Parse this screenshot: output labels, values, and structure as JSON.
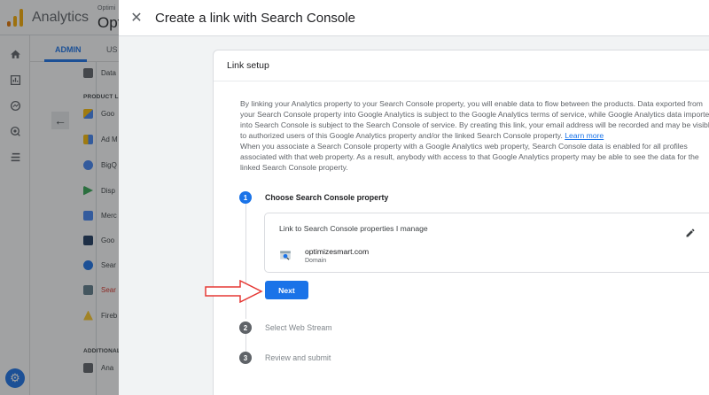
{
  "app": {
    "name": "Analytics",
    "account_label": "Optimi",
    "property_label": "Opt"
  },
  "tabs": [
    {
      "label": "ADMIN",
      "active": true
    },
    {
      "label": "US",
      "active": false
    }
  ],
  "left_nav_icons": [
    "home-icon",
    "reports-icon",
    "explore-icon",
    "advertising-icon",
    "configure-icon"
  ],
  "panel": {
    "top_item": {
      "label": "Data",
      "icon": "data-import-icon"
    },
    "section_product_links": "PRODUCT L",
    "product_links": [
      {
        "label": "Goo",
        "icon": "google-ads-icon"
      },
      {
        "label": "Ad M",
        "icon": "ad-manager-icon"
      },
      {
        "label": "BigQ",
        "icon": "bigquery-icon"
      },
      {
        "label": "Disp",
        "icon": "display-video-icon"
      },
      {
        "label": "Merc",
        "icon": "merchant-center-icon"
      },
      {
        "label": "Goo",
        "icon": "google-play-icon"
      },
      {
        "label": "Sear",
        "icon": "search-ads-icon"
      },
      {
        "label": "Sear",
        "icon": "search-console-icon"
      },
      {
        "label": "Fireb",
        "icon": "firebase-icon"
      }
    ],
    "section_additional": "ADDITIONAL",
    "additional_items": [
      {
        "label": "Ana",
        "icon": "analytics-intelligence-icon"
      }
    ]
  },
  "sheet": {
    "title": "Create a link with Search Console",
    "card_title": "Link setup",
    "intro_text": "By linking your Analytics property to your Search Console property, you will enable data to flow between the products. Data exported from your Search Console property into Google Analytics is subject to the Google Analytics terms of service, while Google Analytics data imported into Search Console is subject to the Search Console of service. By creating this link, your email address will be recorded and may be visible to authorized users of this Google Analytics property and/or the linked Search Console property.",
    "learn_more": "Learn more",
    "intro_text_2": "When you associate a Search Console property with a Google Analytics web property, Search Console data is enabled for all profiles associated with that web property. As a result, anybody with access to that Google Analytics property may be able to see the data for the linked Search Console property.",
    "steps": [
      {
        "number": "1",
        "label": "Choose Search Console property",
        "active": true
      },
      {
        "number": "2",
        "label": "Select Web Stream",
        "active": false
      },
      {
        "number": "3",
        "label": "Review and submit",
        "active": false
      }
    ],
    "property_box": {
      "label": "Link to Search Console properties I manage",
      "property_name": "optimizesmart.com",
      "property_type": "Domain"
    },
    "next_label": "Next"
  },
  "colors": {
    "accent": "#1a73e8",
    "logo_orange": "#f9ab00",
    "annotation_arrow": "#e53935"
  }
}
